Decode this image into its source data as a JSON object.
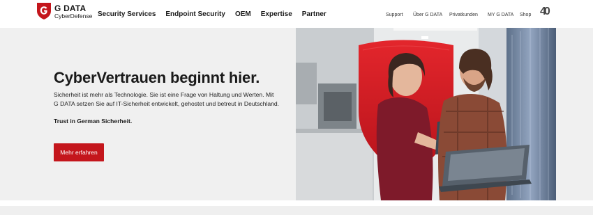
{
  "brand": {
    "name": "G DATA",
    "subtitle": "CyberDefense",
    "accent": "#c4161c"
  },
  "main_nav": [
    {
      "label": "Security Services"
    },
    {
      "label": "Endpoint Security"
    },
    {
      "label": "OEM"
    },
    {
      "label": "Expertise"
    },
    {
      "label": "Partner"
    }
  ],
  "meta_nav": [
    {
      "label": "Support"
    },
    {
      "label": "Über G DATA"
    },
    {
      "label": "Privatkunden"
    },
    {
      "label": "MY G DATA"
    },
    {
      "label": "Shop"
    }
  ],
  "badge": {
    "text": "40"
  },
  "hero": {
    "title": "CyberVertrauen beginnt hier.",
    "text_line1": "Sicherheit ist mehr als Technologie. Sie ist eine Frage von Haltung und Werten. Mit",
    "text_line2": "G DATA setzen Sie auf IT-Sicherheit entwickelt, gehostet und betreut in Deutschland.",
    "tagline": "Trust in German Sicherheit.",
    "cta_label": "Mehr erfahren"
  }
}
